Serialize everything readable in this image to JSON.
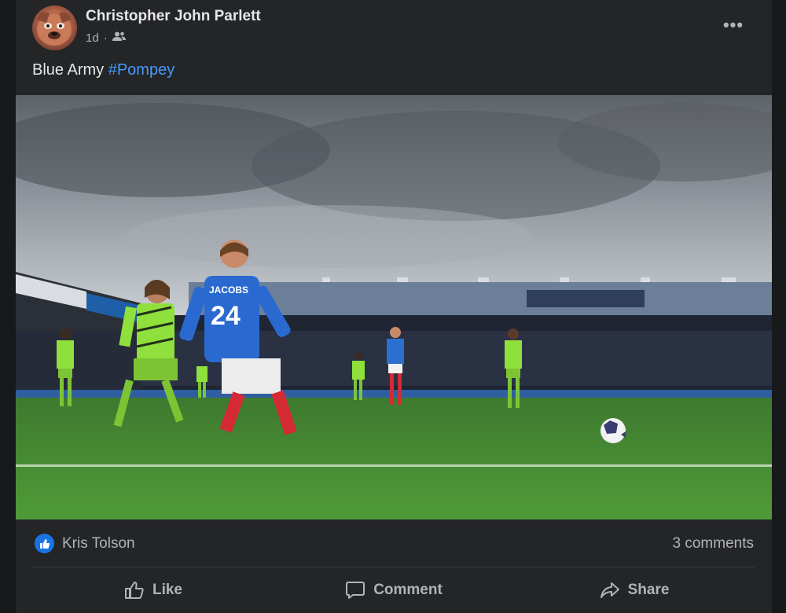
{
  "post": {
    "author": "Christopher John Parlett",
    "time": "1d",
    "audience_icon": "friends-icon",
    "caption_text": "Blue Army ",
    "caption_hashtag": "#Pompey"
  },
  "photo": {
    "player_shirt_name": "JACOBS",
    "player_shirt_number": "24"
  },
  "reactions": {
    "reactor": "Kris Tolson",
    "comments": "3 comments"
  },
  "actions": {
    "like": "Like",
    "comment": "Comment",
    "share": "Share"
  },
  "colors": {
    "background": "#242526",
    "text": "#e4e6eb",
    "muted": "#b0b3b8",
    "link": "#4599ff",
    "like_blue": "#1b74e4"
  }
}
